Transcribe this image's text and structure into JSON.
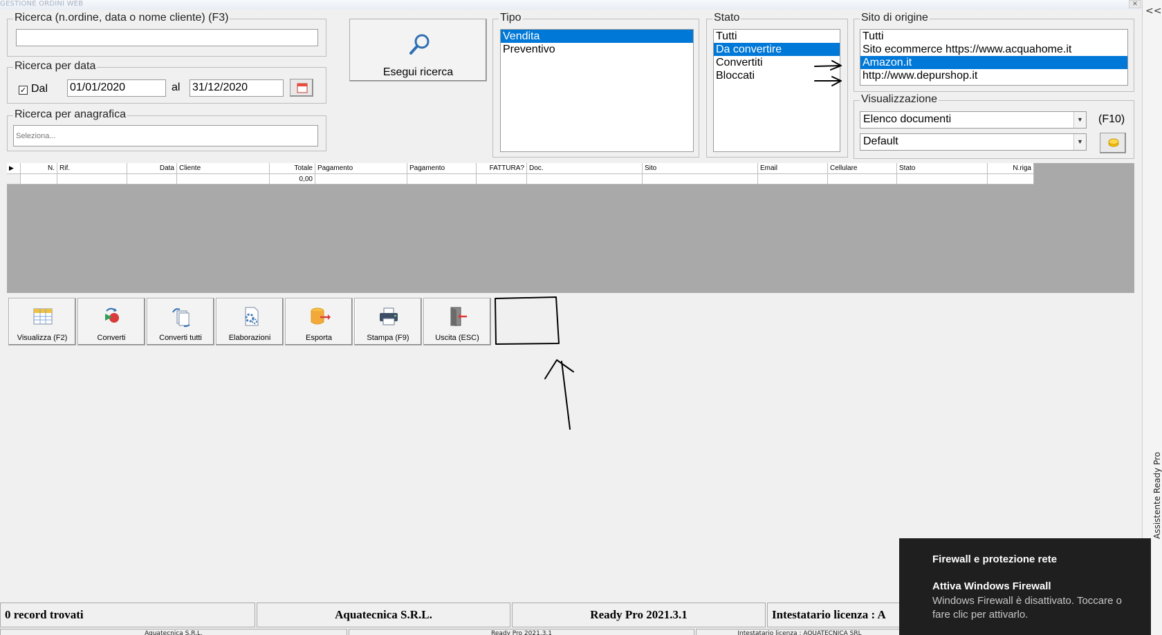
{
  "window": {
    "title": "GESTIONE ORDINI WEB",
    "close": "×"
  },
  "search": {
    "label": "Ricerca (n.ordine, data o nome cliente) (F3)",
    "value": ""
  },
  "date_search": {
    "label": "Ricerca per data",
    "dal_checked": true,
    "dal_label": "Dal",
    "from": "01/01/2020",
    "al_label": "al",
    "to": "31/12/2020"
  },
  "anagrafica": {
    "label": "Ricerca per anagrafica",
    "placeholder": "Seleziona..."
  },
  "run_search": {
    "label": "Esegui ricerca"
  },
  "tipo": {
    "label": "Tipo",
    "items": [
      "Vendita",
      "Preventivo"
    ],
    "selected": 0
  },
  "stato": {
    "label": "Stato",
    "items": [
      "Tutti",
      "Da convertire",
      "Convertiti",
      "Bloccati"
    ],
    "selected": 1
  },
  "sito": {
    "label": "Sito di origine",
    "items": [
      "Tutti",
      "Sito ecommerce https://www.acquahome.it",
      "Amazon.it",
      "http://www.depurshop.it"
    ],
    "selected": 2
  },
  "visualizzazione": {
    "label": "Visualizzazione",
    "mode": "Elenco documenti",
    "hotkey": "(F10)",
    "preset": "Default"
  },
  "grid": {
    "columns": [
      "N.",
      "Rif.",
      "Data",
      "Cliente",
      "Totale",
      "Pagamento",
      "Pagamento",
      "FATTURA?",
      "Doc.",
      "Sito",
      "Email",
      "Cellulare",
      "Stato",
      "N.riga"
    ],
    "row": [
      "",
      "",
      "",
      "",
      "0,00",
      "",
      "",
      "",
      "",
      "",
      "",
      "",
      "",
      ""
    ]
  },
  "toolbar": [
    {
      "label": "Visualizza (F2)",
      "icon": "grid-view-icon"
    },
    {
      "label": "Converti",
      "icon": "convert-icon"
    },
    {
      "label": "Converti tutti",
      "icon": "convert-all-icon"
    },
    {
      "label": "Elaborazioni",
      "icon": "processing-icon"
    },
    {
      "label": "Esporta",
      "icon": "export-icon"
    },
    {
      "label": "Stampa (F9)",
      "icon": "printer-icon"
    },
    {
      "label": "Uscita (ESC)",
      "icon": "exit-icon"
    }
  ],
  "status": {
    "records": "0 record trovati",
    "company": "Aquatecnica S.R.L.",
    "version": "Ready Pro 2021.3.1",
    "license": "Intestatario licenza : A"
  },
  "status2": {
    "company": "Aquatecnica S.R.L.",
    "version": "Ready Pro 2021.3.1",
    "license": "Intestatario licenza : AQUATECNICA SRL"
  },
  "toast": {
    "heading": "Firewall e protezione rete",
    "title": "Attiva Windows Firewall",
    "body": "Windows Firewall è disattivato. Toccare o fare clic per attivarlo."
  },
  "assistant": {
    "label": "Assistente Ready Pro",
    "collapse": "<<"
  }
}
